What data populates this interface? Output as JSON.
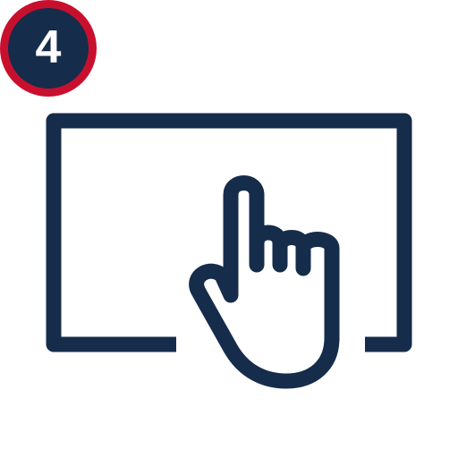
{
  "badge": {
    "number": "4",
    "ring_color": "#c8102e",
    "fill_color": "#162c4b",
    "text_color": "#ffffff"
  },
  "illustration": {
    "icon": "touchscreen-tap-icon",
    "stroke_color": "#162c4b"
  }
}
